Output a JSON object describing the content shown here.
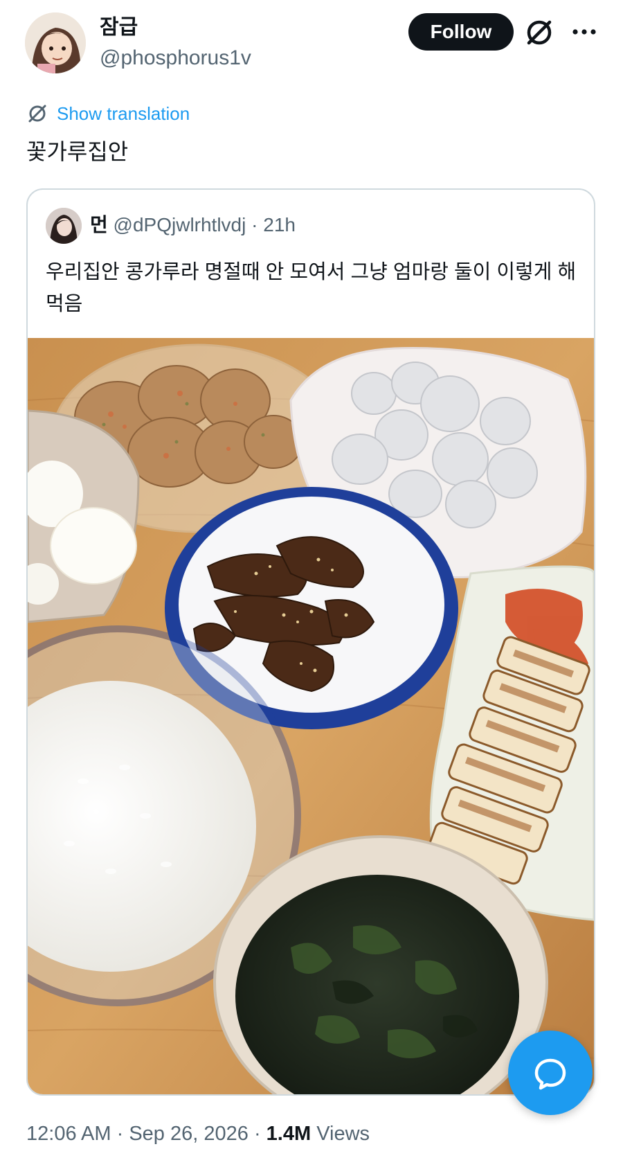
{
  "author": {
    "display_name": "잠급",
    "handle": "@phosphorus1v",
    "avatar_icon": "cartoon-avatar"
  },
  "header_actions": {
    "follow_label": "Follow",
    "grok_icon": "grok-icon",
    "more_icon": "more-icon"
  },
  "translate": {
    "label": "Show translation",
    "icon": "grok-icon"
  },
  "tweet": {
    "text": "꽃가루집안"
  },
  "quote": {
    "name": "먼",
    "handle": "@dPQjwlrhtlvdj",
    "separator": "·",
    "time": "21h",
    "text": "우리집안 콩가루라 명절때 안 모여서 그냥 엄마랑 둘이 이렇게 해먹음"
  },
  "meta": {
    "time": "12:06 AM",
    "separator": "·",
    "date": "Sep 26, 2026",
    "views_count": "1.4M",
    "views_label": "Views"
  },
  "fab": {
    "icon": "message-bubble-icon"
  },
  "colors": {
    "accent": "#1d9bf0",
    "text_primary": "#0f1419",
    "text_secondary": "#536471",
    "border": "#cfd9de",
    "button_dark": "#0f1419"
  }
}
